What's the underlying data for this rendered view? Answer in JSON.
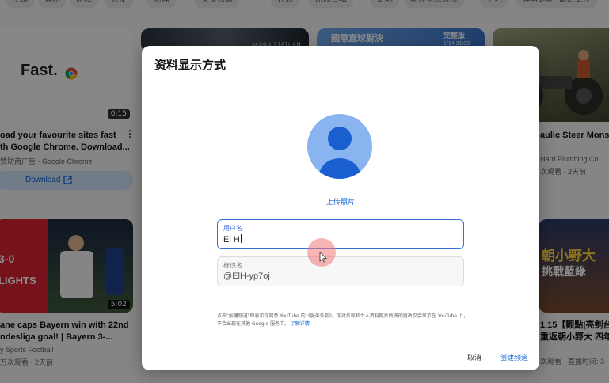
{
  "chips": [
    "全部",
    "音乐",
    "游戏",
    "天使",
    "新闻",
    "美食频道",
    "计划",
    "游戏合辑",
    "足球",
    "动作冒险游戏",
    "学习",
    "体育运动游戏",
    "最近上传",
    "发现新视频"
  ],
  "videos": [
    {
      "thumb_text": "Fast.",
      "duration": "0:15",
      "title_line1": "oad your favourite sites fast",
      "title_line2": "th Google Chrome. Download...",
      "meta": "赞助商广告 · Google Chrome",
      "cta": "Download"
    },
    {
      "thumb_text": "JASON STATHAM",
      "duration": ""
    },
    {
      "thumb_text": "國際直球對決",
      "badge": "完整版",
      "badge_time": "1/14 21:00"
    },
    {
      "title": "aulic Steer Monste",
      "channel": "Hard Plumbing Co",
      "meta": "次观看 · 2天前"
    },
    {
      "thumb_score": "3-0",
      "thumb_highlights": "LIGHTS",
      "duration": "5:02",
      "title_line1": "ane caps Bayern win with 22nd",
      "title_line2": "ndesliga goal! | Bayern 3-...",
      "channel": "y Sports Football",
      "meta": "万次观看 · 2天前"
    },
    {
      "thumb_text": "朝小野大",
      "thumb_sub": "挑戰藍綠",
      "title_line1": "1.15【觀點|亮劍台",
      "title_line2": "重返朝小野大 四年",
      "meta": "次观看 · 直播时间: 3"
    }
  ],
  "dialog": {
    "title": "资料显示方式",
    "upload_label": "上传照片",
    "name_label": "用户名",
    "name_value": "El H",
    "handle_label": "标识名",
    "handle_value": "@ElH-yp7oj",
    "terms_text": "点击\"创建频道\"即表示你同意 YouTube 的《服务条款》。你对名称和个人资料照片所做的更改仅会显示在 YouTube 上，不会出现在其他 Google 服务中。",
    "terms_link": "了解详情",
    "cancel_label": "取消",
    "create_label": "创建频道"
  },
  "colors": {
    "accent": "#065fd4",
    "field_focus": "#3a6fd8",
    "avatar_bg": "#8ab4f0",
    "avatar_fg": "#1a5fd0"
  }
}
